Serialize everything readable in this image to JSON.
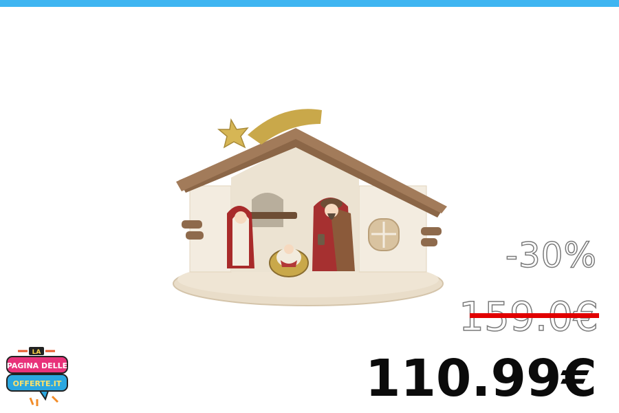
{
  "colors": {
    "top_bar": "#3fb5f1",
    "strike": "#e10000",
    "price": "#0b0b0b",
    "outline_text": "#7a7a7a"
  },
  "product": {
    "image": "ceramic-nativity-hut"
  },
  "pricing": {
    "discount": "-30%",
    "original_price": "159.0€",
    "sale_price": "110.99€"
  },
  "logo": {
    "line1": "LA",
    "line2": "PAGINA DELLE",
    "line3": "OFFERTE.IT"
  }
}
